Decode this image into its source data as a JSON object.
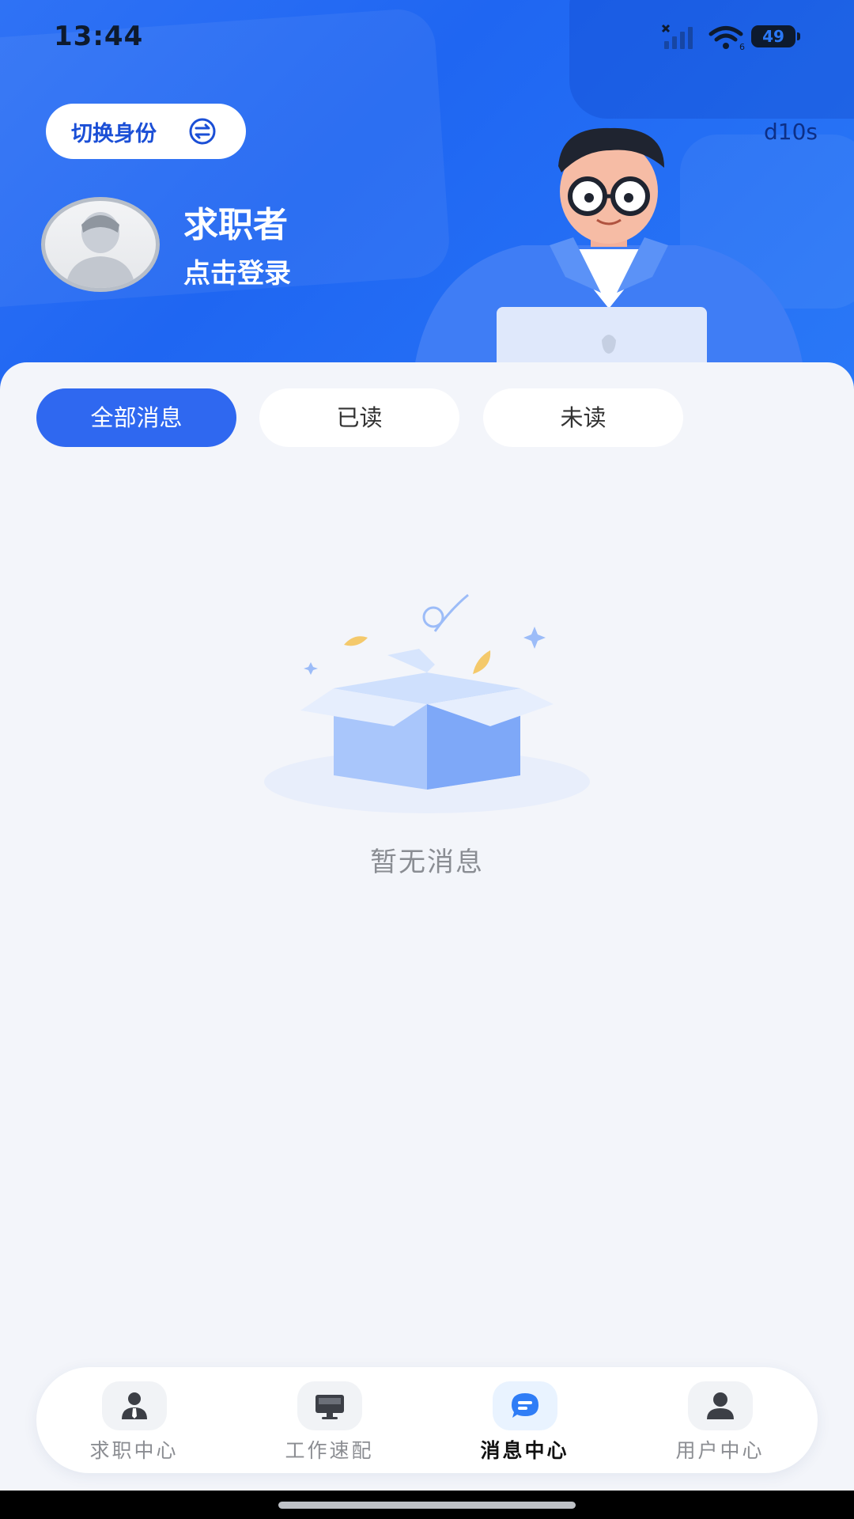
{
  "status_bar": {
    "time": "13:44",
    "battery": "49",
    "icons": [
      "cellular-signal-icon",
      "wifi-icon",
      "battery-icon"
    ]
  },
  "header": {
    "switch_identity_label": "切换身份",
    "tag_code": "d10s",
    "user_role": "求职者",
    "login_prompt": "点击登录"
  },
  "tabs": [
    {
      "label": "全部消息",
      "active": true
    },
    {
      "label": "已读",
      "active": false
    },
    {
      "label": "未读",
      "active": false
    }
  ],
  "empty_state": {
    "text": "暂无消息"
  },
  "bottom_nav": [
    {
      "label": "求职中心",
      "icon": "job-seeker-icon",
      "active": false
    },
    {
      "label": "工作速配",
      "icon": "monitor-icon",
      "active": false
    },
    {
      "label": "消息中心",
      "icon": "chat-bubble-icon",
      "active": true
    },
    {
      "label": "用户中心",
      "icon": "user-icon",
      "active": false
    }
  ],
  "colors": {
    "primary": "#2f68f0",
    "header_blue": "#2a72f5",
    "background": "#f3f5fa"
  }
}
